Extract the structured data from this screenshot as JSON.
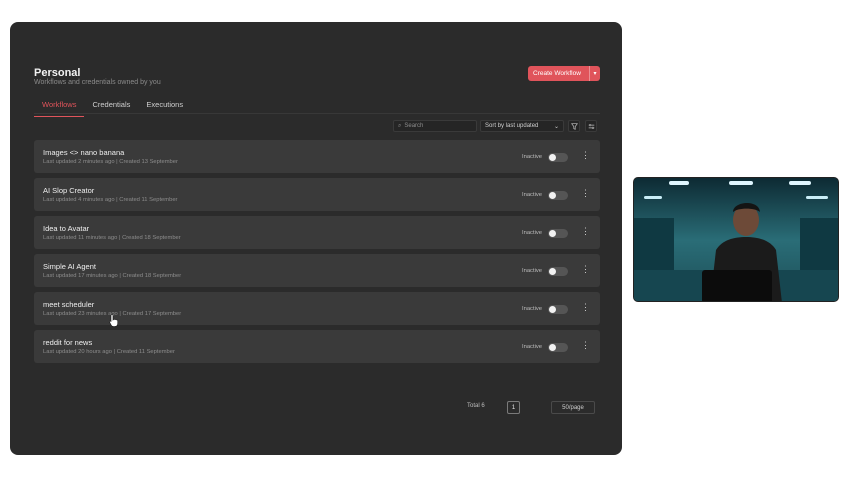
{
  "header": {
    "title": "Personal",
    "subtitle": "Workflows and credentials owned by you",
    "create_button_label": "Create Workflow"
  },
  "tabs": [
    {
      "label": "Workflows",
      "active": true
    },
    {
      "label": "Credentials",
      "active": false
    },
    {
      "label": "Executions",
      "active": false
    }
  ],
  "toolbar": {
    "search_placeholder": "Search",
    "sort_value": "Sort by last updated"
  },
  "workflows": [
    {
      "name": "Images <> nano banana",
      "meta": "Last updated 2 minutes ago | Created 13 September",
      "status": "Inactive"
    },
    {
      "name": "AI Slop Creator",
      "meta": "Last updated 4 minutes ago | Created 11 September",
      "status": "Inactive"
    },
    {
      "name": "Idea to Avatar",
      "meta": "Last updated 11 minutes ago | Created 18 September",
      "status": "Inactive"
    },
    {
      "name": "Simple AI Agent",
      "meta": "Last updated 17 minutes ago | Created 18 September",
      "status": "Inactive"
    },
    {
      "name": "meet scheduler",
      "meta": "Last updated 23 minutes ago | Created 17 September",
      "status": "Inactive"
    },
    {
      "name": "reddit for news",
      "meta": "Last updated 20 hours ago | Created 11 September",
      "status": "Inactive"
    }
  ],
  "pagination": {
    "total_label": "Total 6",
    "current_page": "1",
    "per_page": "50/page"
  },
  "colors": {
    "accent": "#e0545b",
    "panel_bg": "#2b2b2b",
    "row_bg": "#3a3a3a"
  }
}
